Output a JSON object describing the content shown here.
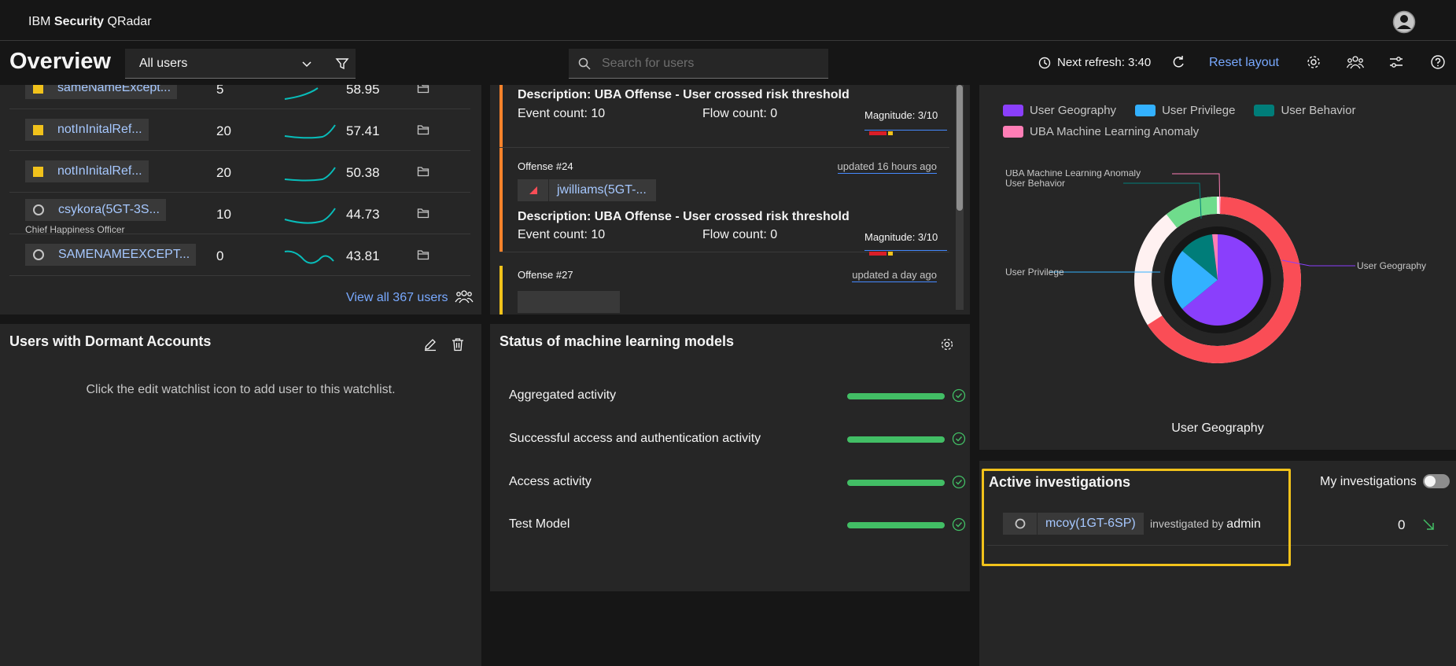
{
  "app": {
    "brand_prefix": "IBM",
    "brand_bold": "Security",
    "brand_suffix": "QRadar"
  },
  "header": {
    "title": "Overview",
    "user_filter": "All users",
    "search_placeholder": "Search for users",
    "next_refresh": "Next refresh: 3:40",
    "reset_layout": "Reset layout"
  },
  "users_panel": {
    "rows": [
      {
        "name": "sameNameExcept...",
        "count": "5",
        "score": "58.95",
        "marker": "square"
      },
      {
        "name": "notInInitalRef...",
        "count": "20",
        "score": "57.41",
        "marker": "square"
      },
      {
        "name": "notInInitalRef...",
        "count": "20",
        "score": "50.38",
        "marker": "square"
      },
      {
        "name": "csykora(5GT-3S...",
        "count": "10",
        "score": "44.73",
        "marker": "circle",
        "subtitle": "Chief Happiness Officer"
      },
      {
        "name": "SAMENAMEEXCEPT...",
        "count": "0",
        "score": "43.81",
        "marker": "circle"
      }
    ],
    "view_all": "View all 367 users"
  },
  "offenses_panel": {
    "offenses": [
      {
        "description": "Description: UBA Offense - User crossed risk threshold",
        "event_count": "Event count: 10",
        "flow_count": "Flow count: 0",
        "magnitude": "Magnitude: 3/10",
        "bar_color": "#ff832b"
      },
      {
        "label": "Offense #24",
        "updated": "updated 16 hours ago",
        "user": "jwilliams(5GT-...",
        "description": "Description: UBA Offense - User crossed risk threshold",
        "event_count": "Event count: 10",
        "flow_count": "Flow count: 0",
        "magnitude": "Magnitude: 3/10",
        "bar_color": "#ff832b"
      },
      {
        "label": "Offense #27",
        "updated": "updated a day ago",
        "bar_color": "#f1c21b"
      }
    ]
  },
  "geo_panel": {
    "legend": [
      {
        "name": "User Geography",
        "color": "#8a3ffc"
      },
      {
        "name": "User Privilege",
        "color": "#33b1ff"
      },
      {
        "name": "User Behavior",
        "color": "#007d79"
      },
      {
        "name": "UBA Machine Learning Anomaly",
        "color": "#ff7eb6"
      }
    ],
    "callouts": {
      "anomaly": "UBA Machine Learning Anomaly",
      "behavior": "User Behavior",
      "privilege": "User Privilege",
      "geography": "User Geography"
    },
    "selected_label": "User Geography",
    "outer_ring_colors": {
      "red": "#fa4d56",
      "light": "#fff1f1",
      "green": "#6fdc8c"
    }
  },
  "dormant_panel": {
    "title": "Users with Dormant Accounts",
    "message": "Click the edit watchlist icon to add user to this watchlist."
  },
  "ml_panel": {
    "title": "Status of machine learning models",
    "models": [
      {
        "name": "Aggregated activity"
      },
      {
        "name": "Successful access and authentication activity"
      },
      {
        "name": "Access activity"
      },
      {
        "name": "Test Model"
      }
    ]
  },
  "investigations_panel": {
    "title": "Active investigations",
    "my_investigations": "My investigations",
    "rows": [
      {
        "user": "mcoy(1GT-6SP)",
        "investigated_by_label": "investigated by",
        "investigator": "admin",
        "count": "0"
      }
    ]
  }
}
